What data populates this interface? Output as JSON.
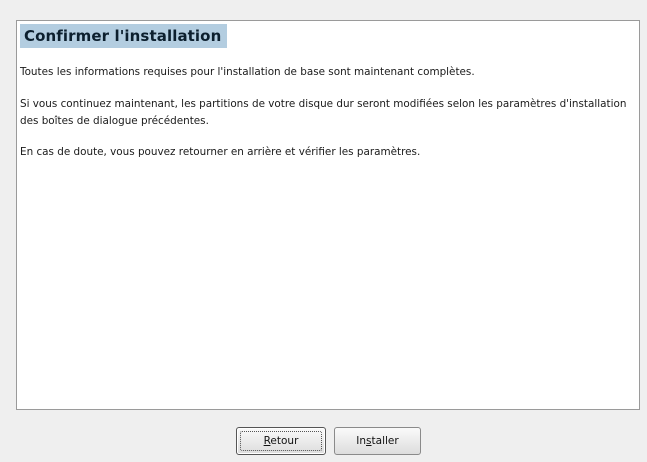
{
  "page": {
    "heading": "Confirmer l'installation",
    "paragraphs": [
      "Toutes les informations requises pour l'installation de base sont maintenant complètes.",
      "Si vous continuez maintenant, les partitions de votre disque dur seront modifiées selon les paramètres d'installation des boîtes de dialogue précédentes.",
      "En cas de doute, vous pouvez retourner en arrière et vérifier les paramètres."
    ]
  },
  "buttons": {
    "back": {
      "mnemonic": "R",
      "rest": "etour",
      "focused": true
    },
    "install": {
      "pre": "In",
      "mnemonic": "s",
      "rest": "taller"
    }
  },
  "colors": {
    "background": "#efefef",
    "heading_highlight": "#b3cde0"
  }
}
